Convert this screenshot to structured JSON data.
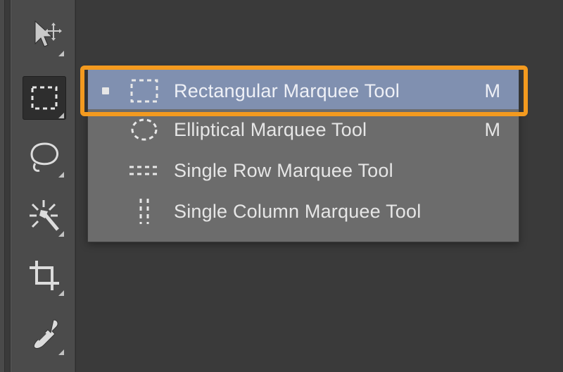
{
  "toolbar": {
    "tools": [
      "move",
      "marquee",
      "lasso",
      "wand",
      "crop",
      "eyedropper"
    ],
    "selected_index": 1
  },
  "flyout_menu": {
    "highlighted_index": 0,
    "current_index": 0,
    "items": [
      {
        "icon": "rectangular-marquee",
        "label": "Rectangular Marquee Tool",
        "shortcut": "M"
      },
      {
        "icon": "elliptical-marquee",
        "label": "Elliptical Marquee Tool",
        "shortcut": "M"
      },
      {
        "icon": "single-row-marquee",
        "label": "Single Row Marquee Tool",
        "shortcut": ""
      },
      {
        "icon": "single-col-marquee",
        "label": "Single Column Marquee Tool",
        "shortcut": ""
      }
    ]
  },
  "colors": {
    "panel_bg": "#4b4b4b",
    "canvas_bg": "#3a3a3a",
    "menu_bg": "#6c6c6c",
    "highlight_row": "#8090b0",
    "text": "#e6e6e6",
    "ring": "#f39a1f"
  }
}
